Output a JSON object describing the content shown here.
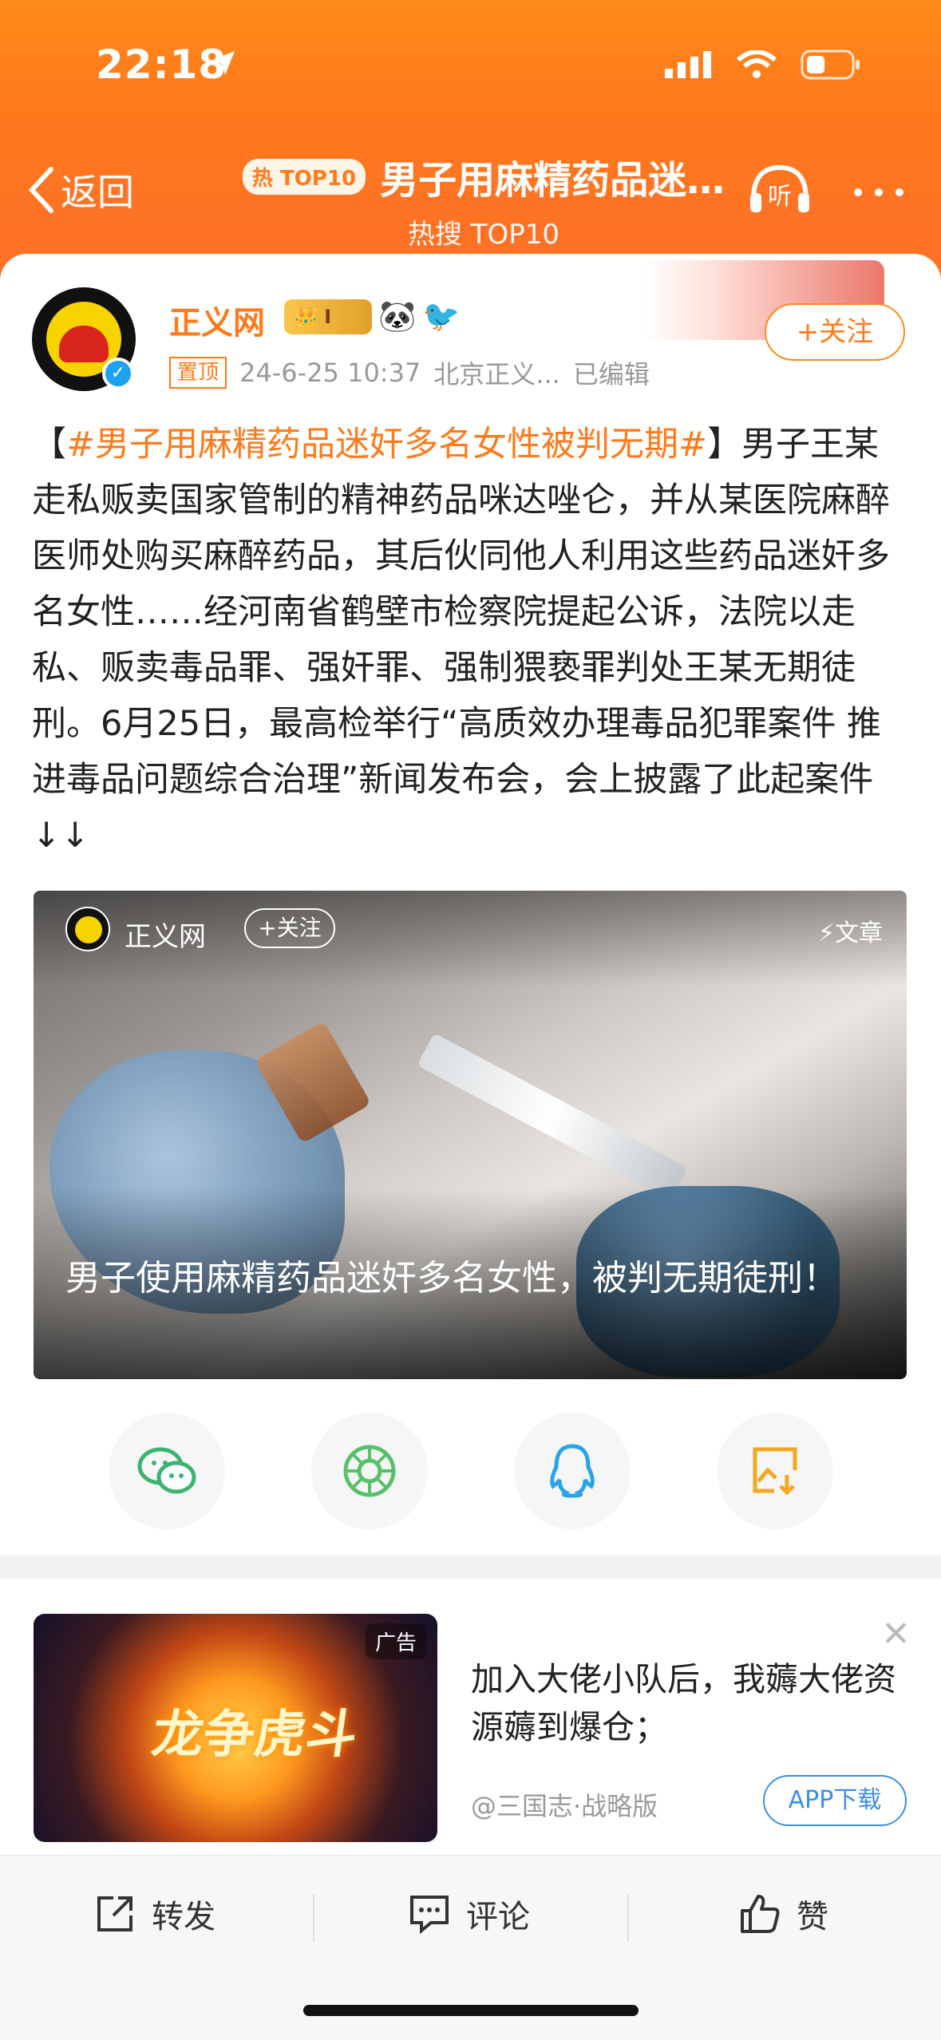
{
  "status_bar": {
    "time": "22:18"
  },
  "nav": {
    "back_label": "返回",
    "hot_badge": "热 TOP10",
    "title": "男子用麻精药品迷…",
    "subtitle": "热搜 TOP10",
    "listen_label": "听"
  },
  "post": {
    "author": "正义网",
    "verified": "✓",
    "level_badge": "I",
    "follow_label": "+关注",
    "pin_tag": "置顶",
    "timestamp": "24-6-25 10:37",
    "source": "北京正义...",
    "edited": "已编辑",
    "text_open_bracket": "【",
    "hashtag": "#男子用麻精药品迷奸多名女性被判无期#",
    "text_body": "】男子王某走私贩卖国家管制的精神药品咪达唑仑，并从某医院麻醉医师处购买麻醉药品，其后伙同他人利用这些药品迷奸多名女性……经河南省鹤壁市检察院提起公诉，法院以走私、贩卖毒品罪、强奸罪、强制猥亵罪判处王某无期徒刑。6月25日，最高检举行“高质效办理毒品犯罪案件 推进毒品问题综合治理”新闻发布会，会上披露了此起案件 ↓↓"
  },
  "article": {
    "author": "正义网",
    "follow_label": "+关注",
    "type_label": "⚡文章",
    "caption": "男子使用麻精药品迷奸多名女性，被判无期徒刑！"
  },
  "share": {
    "items": [
      "wechat-icon",
      "moments-icon",
      "qq-icon",
      "save-image-icon"
    ]
  },
  "ad": {
    "label": "广告",
    "art_title": "龙争虎斗",
    "text": "加入大佬小队后，我薅大佬资源薅到爆仓；",
    "source": "@三国志·战略版",
    "download_label": "APP下载",
    "close": "✕"
  },
  "actions": {
    "repost": "转发",
    "comment": "评论",
    "like": "赞"
  },
  "colors": {
    "accent": "#ff7a1b",
    "link_blue": "#3d8fe2"
  }
}
